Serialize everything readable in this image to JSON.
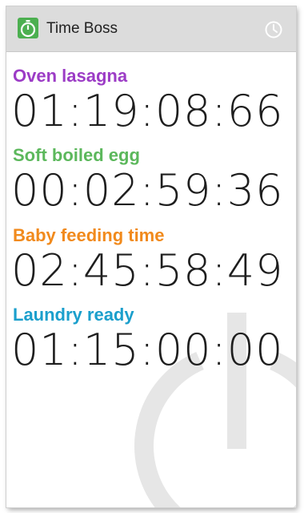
{
  "app": {
    "title": "Time Boss",
    "icon": "stopwatch-icon",
    "accent_color": "#4caf50",
    "action_icon": "clock-history-icon"
  },
  "timers": [
    {
      "name": "Oven lasagna",
      "time": "01:19:08:66",
      "color": "#9c3cc6"
    },
    {
      "name": "Soft boiled egg",
      "time": "00:02:59:36",
      "color": "#5cb85c"
    },
    {
      "name": "Baby feeding time",
      "time": "02:45:58:49",
      "color": "#f18a1c"
    },
    {
      "name": "Laundry ready",
      "time": "01:15:00:00",
      "color": "#1b9fcc"
    }
  ],
  "background": {
    "watermark_icon": "power-icon",
    "watermark_color": "#e6e6e6"
  }
}
